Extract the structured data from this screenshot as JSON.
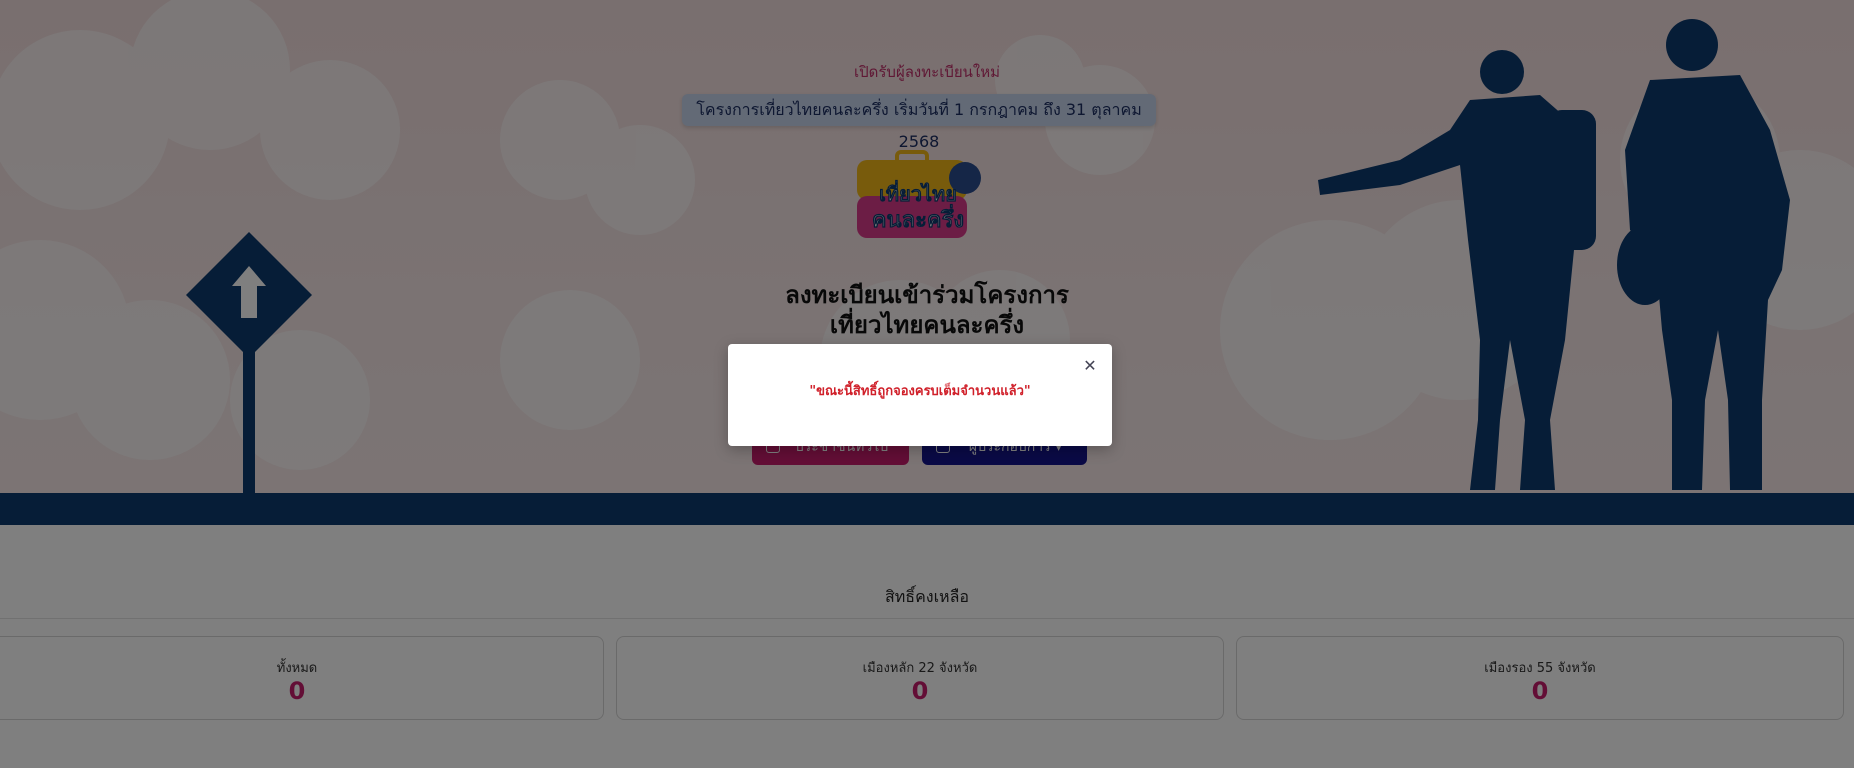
{
  "hero": {
    "announcement": "เปิดรับผู้ลงทะเบียนใหม่",
    "program_banner": "โครงการเที่ยวไทยคนละครึ่ง เริ่มวันที่ 1 กรกฎาคม ถึง 31 ตุลาคม 2568",
    "logo_text": [
      "เที่ยวไทย",
      "คนละครึ่ง"
    ],
    "title_line1": "ลงทะเบียนเข้าร่วมโครงการ",
    "title_line2": "เที่ยวไทยคนละครึ่ง",
    "buttons": {
      "citizen": "ประชาชนทั่วไป",
      "operator": "ผู้ประกอบการ"
    }
  },
  "quota": {
    "title": "สิทธิ์คงเหลือ",
    "cards": [
      {
        "label": "ทั้งหมด",
        "value": "0"
      },
      {
        "label": "เมืองหลัก 22 จังหวัด",
        "value": "0"
      },
      {
        "label": "เมืองรอง 55 จังหวัด",
        "value": "0"
      }
    ]
  },
  "modal": {
    "message": "\"ขณะนี้สิทธิ์ถูกจองครบเต็มจำนวนแล้ว\"",
    "close_icon": "close-icon"
  },
  "colors": {
    "brand_pink": "#c61c6c",
    "brand_navy": "#0d3b6e",
    "operator_blue": "#14148c",
    "error_red": "#d0202a"
  }
}
